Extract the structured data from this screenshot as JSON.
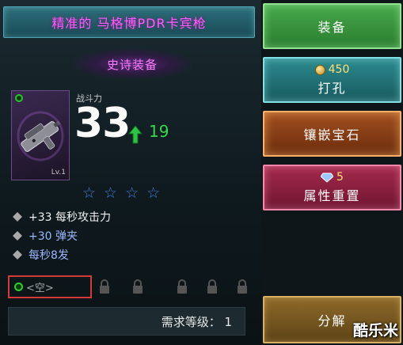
{
  "item": {
    "name": "精准的 马格博PDR卡宾枪",
    "rarity": "史诗装备",
    "level": "Lv.1",
    "power_label": "战斗力",
    "power": "33",
    "power_change": "19",
    "stars_total": 4,
    "stars_filled": 0
  },
  "attributes": [
    {
      "text": "+33 每秒攻击力"
    },
    {
      "text": "+30 弹夹"
    },
    {
      "text": "每秒8发"
    }
  ],
  "socket": {
    "empty_label": "<空>",
    "locked_slots": 5
  },
  "requirement": "需求等级： 1",
  "buttons": {
    "equip": "装备",
    "punch": "打孔",
    "punch_cost": "450",
    "inlay": "镶嵌宝石",
    "reset": "属性重置",
    "reset_cost": "5",
    "dismantle": "分解"
  },
  "watermark": "酷乐米",
  "colors": {
    "title": "#ff5cff",
    "rarity": "#ff7cff",
    "power_up": "#35d94a",
    "attr_blue": "#9ab8ff",
    "highlight_box": "#d33a3a"
  },
  "icons": [
    "gun-icon",
    "up-arrow-icon",
    "star-icon",
    "diamond-bullet-icon",
    "socket-gem-icon",
    "lock-icon",
    "gold-coin-icon",
    "crystal-icon"
  ]
}
